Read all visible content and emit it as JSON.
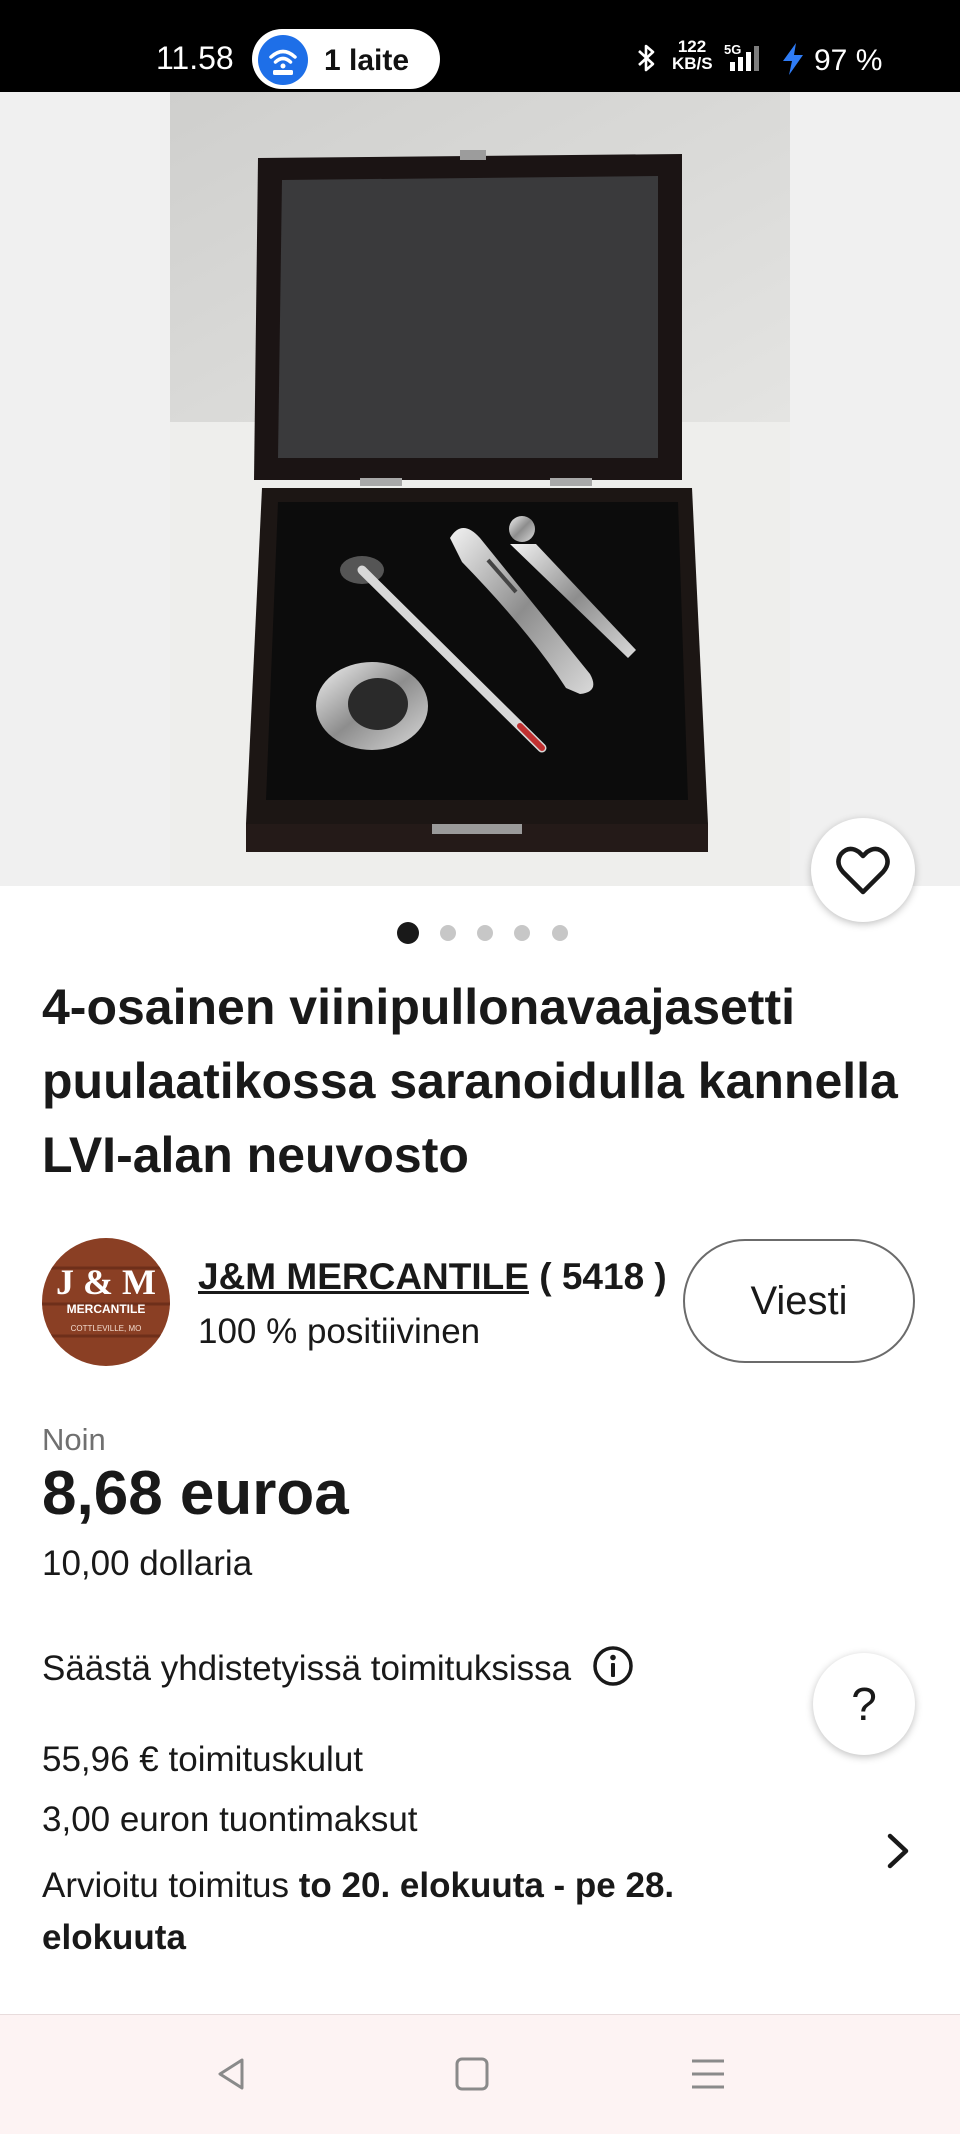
{
  "status_bar": {
    "time": "11.58",
    "connection_pill": "1 laite",
    "net_speed_value": "122",
    "net_speed_unit": "KB/S",
    "network": "5G",
    "battery": "97 %"
  },
  "gallery": {
    "image_count": 5,
    "active_index": 0
  },
  "product": {
    "title": "4-osainen viinipullonavaajasetti puulaatikossa saranoidulla kannella LVI-alan neuvosto"
  },
  "seller": {
    "logo_line1": "J & M",
    "logo_line2": "MERCANTILE",
    "logo_line3": "COTTLEVILLE, MO",
    "name": "J&M MERCANTILE",
    "rating_count": "( 5418 )",
    "feedback": "100 % positiivinen",
    "message_label": "Viesti"
  },
  "price": {
    "approx_label": "Noin",
    "converted": "8,68 euroa",
    "original": "10,00 dollaria"
  },
  "shipping": {
    "combined_label": "Säästä yhdistetyissä toimituksissa",
    "cost": "55,96 € toimituskulut",
    "import_fees": "3,00 euron tuontimaksut",
    "delivery_prefix": "Arvioitu toimitus",
    "delivery_range": "to 20. elokuuta - pe 28. elokuuta"
  },
  "help": {
    "label": "?"
  },
  "colors": {
    "status_bar": "#000000",
    "wifi_badge": "#1e6fe8",
    "text": "#191919",
    "muted": "#707070",
    "nav_bar": "#fdf3f3",
    "logo_wood": "#8a3f24"
  },
  "icons": [
    "wifi-icon",
    "bluetooth-icon",
    "signal-icon",
    "bolt-icon",
    "heart-icon",
    "info-icon",
    "chevron-right-icon",
    "back-icon",
    "home-icon",
    "menu-icon"
  ]
}
